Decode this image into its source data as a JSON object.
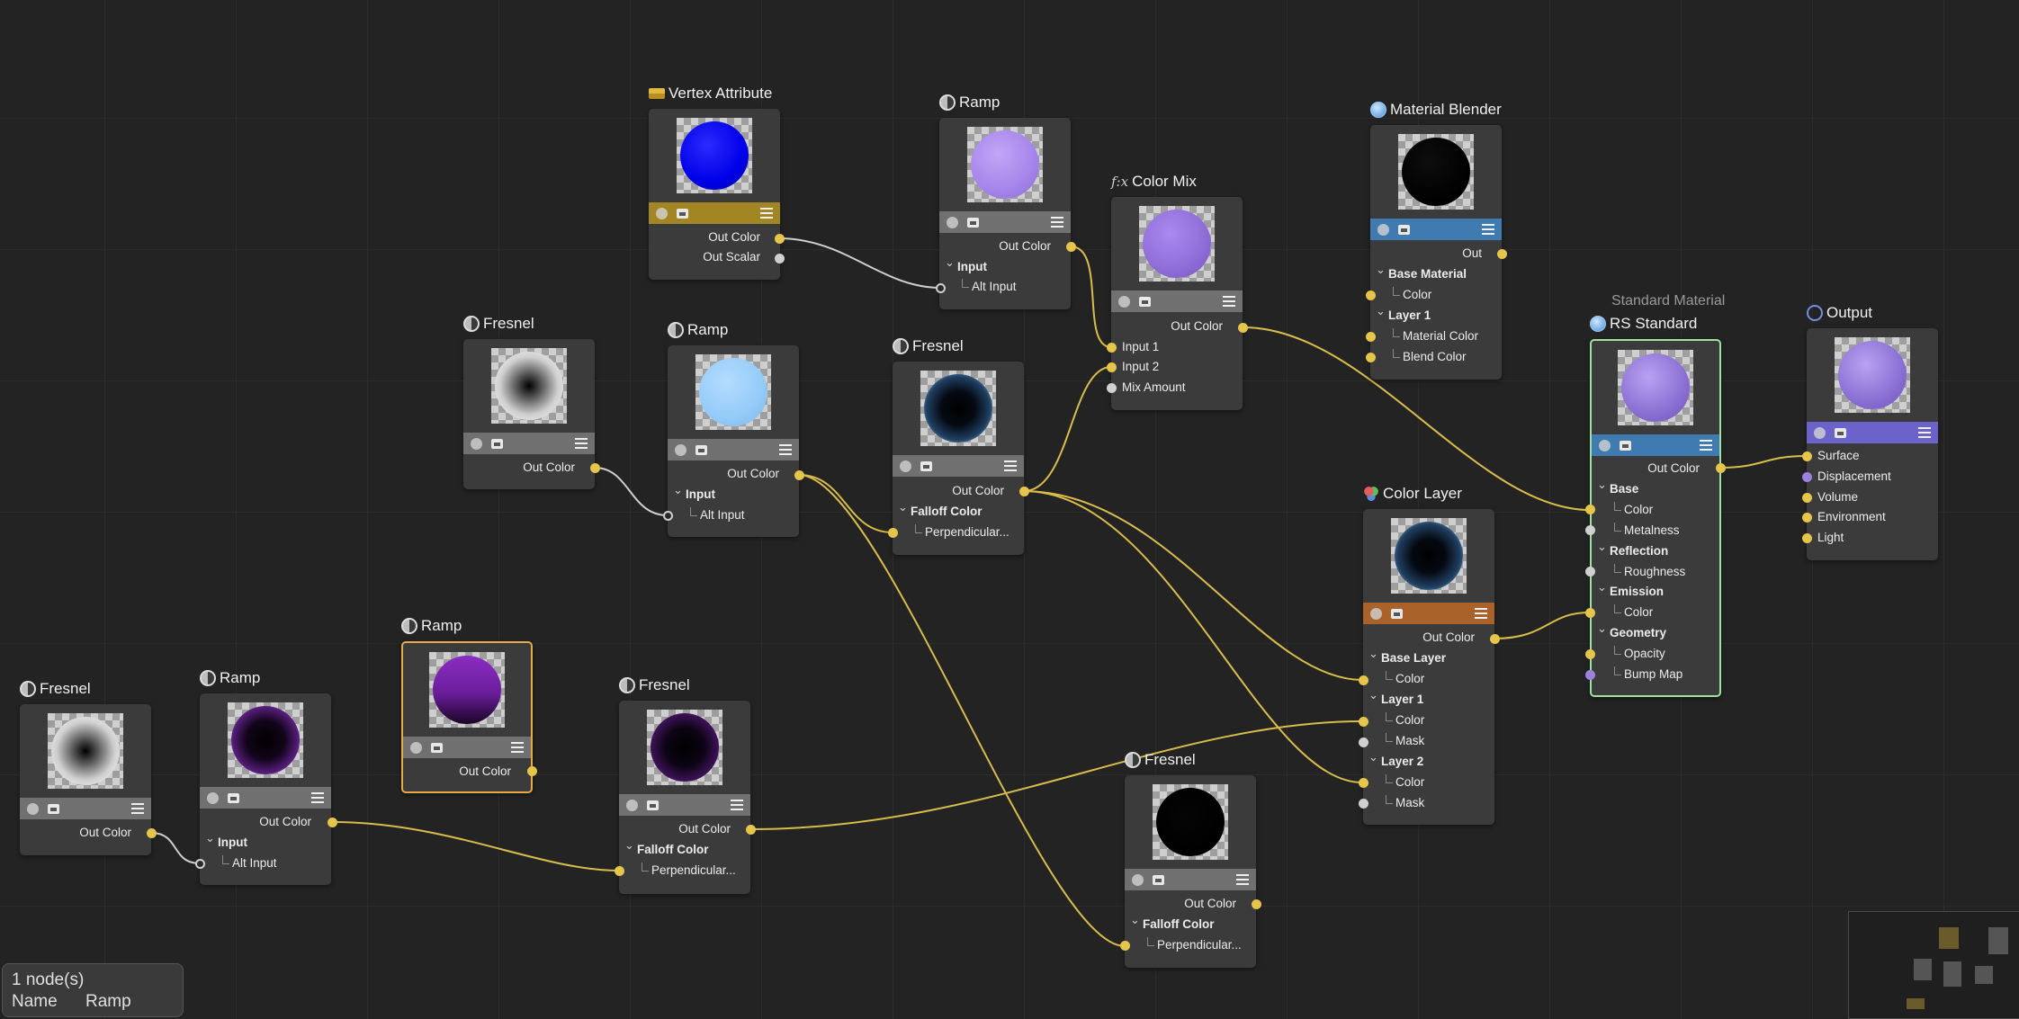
{
  "nodes": {
    "vertex_attribute": {
      "title": "Vertex Attribute",
      "outputs": [
        "Out Color",
        "Out Scalar"
      ]
    },
    "ramp_top": {
      "title": "Ramp",
      "output": "Out Color",
      "group": "Input",
      "input": "Alt Input"
    },
    "color_mix": {
      "title": "Color Mix",
      "output": "Out Color",
      "inputs": [
        "Input 1",
        "Input 2",
        "Mix Amount"
      ]
    },
    "material_blender": {
      "title": "Material Blender",
      "output": "Out",
      "group1": "Base Material",
      "g1_color": "Color",
      "group2": "Layer 1",
      "g2_material": "Material Color",
      "g2_blend": "Blend Color"
    },
    "fresnel_a": {
      "title": "Fresnel",
      "output": "Out Color"
    },
    "ramp_mid": {
      "title": "Ramp",
      "output": "Out Color",
      "group": "Input",
      "input": "Alt Input"
    },
    "fresnel_b": {
      "title": "Fresnel",
      "output": "Out Color",
      "group": "Falloff Color",
      "input": "Perpendicular..."
    },
    "rs_standard": {
      "subtitle": "Standard Material",
      "title": "RS Standard",
      "output": "Out Color",
      "base": "Base",
      "base_color": "Color",
      "metalness": "Metalness",
      "reflection": "Reflection",
      "roughness": "Roughness",
      "emission": "Emission",
      "emission_color": "Color",
      "geometry": "Geometry",
      "opacity": "Opacity",
      "bump": "Bump Map"
    },
    "output": {
      "title": "Output",
      "inputs": [
        "Surface",
        "Displacement",
        "Volume",
        "Environment",
        "Light"
      ]
    },
    "color_layer": {
      "title": "Color Layer",
      "output": "Out Color",
      "base_layer": "Base Layer",
      "bl_color": "Color",
      "layer1": "Layer 1",
      "l1_color": "Color",
      "l1_mask": "Mask",
      "layer2": "Layer 2",
      "l2_color": "Color",
      "l2_mask": "Mask"
    },
    "ramp_sel": {
      "title": "Ramp",
      "output": "Out Color"
    },
    "fresnel_c": {
      "title": "Fresnel",
      "output": "Out Color"
    },
    "ramp_low": {
      "title": "Ramp",
      "output": "Out Color",
      "group": "Input",
      "input": "Alt Input"
    },
    "fresnel_d": {
      "title": "Fresnel",
      "output": "Out Color",
      "group": "Falloff Color",
      "input": "Perpendicular..."
    },
    "fresnel_e": {
      "title": "Fresnel",
      "output": "Out Color",
      "group": "Falloff Color",
      "input": "Perpendicular..."
    }
  },
  "status": {
    "count": "1 node(s)",
    "name_label": "Name",
    "name_value": "Ramp"
  },
  "colors": {
    "wire_yellow": "#d9bd4c",
    "wire_white": "#d0d0d0",
    "port_yellow": "#e6c54b",
    "port_purple": "#9c82de",
    "selected_outline": "#e7a94a",
    "output_outline": "#9fe29b"
  },
  "icons": [
    "node-type-icon",
    "material-icon",
    "formula-icon",
    "attribute-icon",
    "color-layer-icon",
    "output-icon",
    "dollar-icon",
    "image-icon",
    "menu-icon"
  ]
}
